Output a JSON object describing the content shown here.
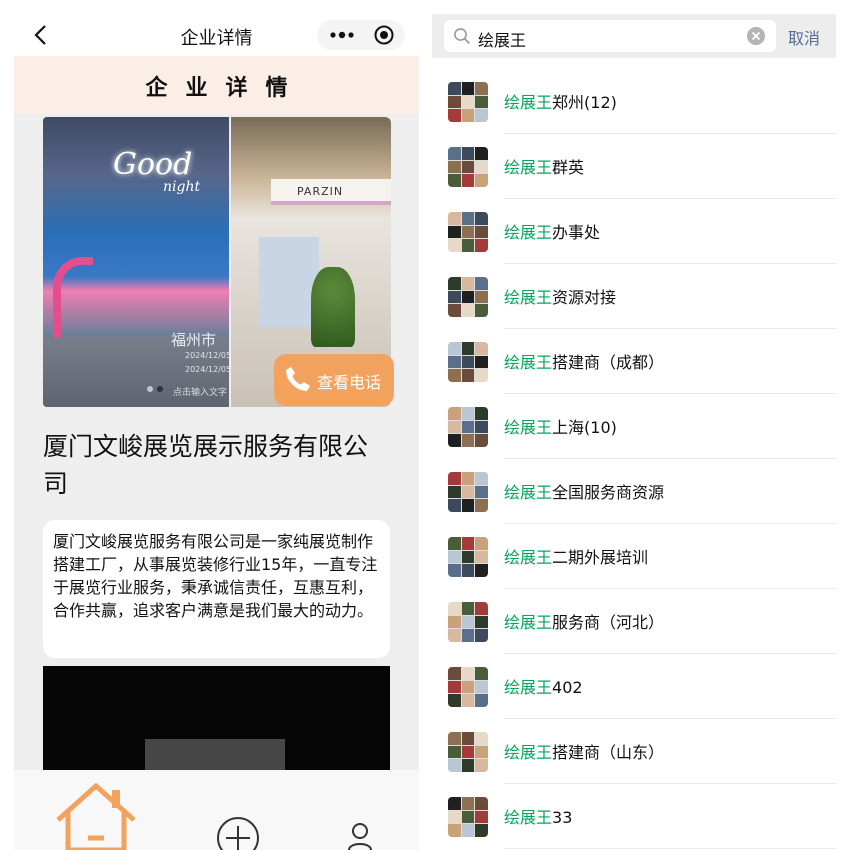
{
  "left_panel": {
    "app_title": "企业详情",
    "page_heading": "企业详情",
    "carousel": {
      "slide1_neon": "Good",
      "slide1_neon_sub": "night",
      "watermark_city": "福州市",
      "watermark_date1": "2024/12/05",
      "watermark_date2": "2024/12/05",
      "dots_caption": "点击输入文字",
      "slide2_booth_name": "PARZIN",
      "call_button_label": "查看电话"
    },
    "company_name": "厦门文峻展览展示服务有限公司",
    "intro": "厦门文峻展览服务有限公司是一家纯展览制作搭建工厂，从事展览装修行业15年，一直专注于展览行业服务，秉承诚信责任，互惠互利，合作共赢，追求客户满意是我们最大的动力。",
    "colors": {
      "accent": "#f3a25e",
      "head_bg": "#fbeee6"
    }
  },
  "right_panel": {
    "search": {
      "query": "绘展王",
      "cancel_label": "取消"
    },
    "highlight_color": "#07a55b",
    "results": [
      {
        "keyword": "绘展王",
        "suffix": "郑州(12)"
      },
      {
        "keyword": "绘展王",
        "suffix": "群英"
      },
      {
        "keyword": "绘展王",
        "suffix": "办事处"
      },
      {
        "keyword": "绘展王",
        "suffix": "资源对接"
      },
      {
        "keyword": "绘展王",
        "suffix": "搭建商（成都）"
      },
      {
        "keyword": "绘展王",
        "suffix": "上海(10)"
      },
      {
        "keyword": "绘展王",
        "suffix": "全国服务商资源"
      },
      {
        "keyword": "绘展王",
        "suffix": "二期外展培训"
      },
      {
        "keyword": "绘展王",
        "suffix": "服务商（河北）"
      },
      {
        "keyword": "绘展王",
        "suffix": "402"
      },
      {
        "keyword": "绘展王",
        "suffix": "搭建商（山东）"
      },
      {
        "keyword": "绘展王",
        "suffix": "33"
      }
    ]
  }
}
